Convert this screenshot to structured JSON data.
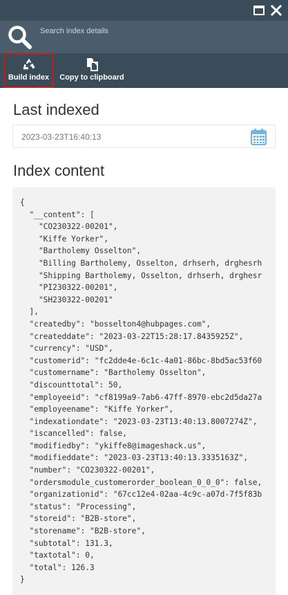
{
  "search": {
    "placeholder": "Search index details"
  },
  "toolbar": {
    "build_label": "Build index",
    "copy_label": "Copy to clipboard"
  },
  "icons": {
    "maximize": "maximize-icon",
    "close": "close-icon",
    "search": "search-icon",
    "build": "recycle-icon",
    "copy": "copy-icon",
    "calendar": "calendar-icon"
  },
  "colors": {
    "titlebar": "#3a4b59",
    "search_bar": "#4b5d6c",
    "highlight_border": "#c01d1d",
    "calendar_icon": "#74b3dc",
    "code_background": "#f2f2f2"
  },
  "last_indexed": {
    "heading": "Last indexed",
    "value": "2023-03-23T16:40:13"
  },
  "index_content": {
    "heading": "Index content",
    "lines": [
      "{",
      "  \"__content\": [",
      "    \"CO230322-00201\",",
      "    \"Kiffe Yorker\",",
      "    \"Bartholemy Osselton\",",
      "    \"Billing Bartholemy, Osselton, drhserh, drghesrh",
      "    \"Shipping Bartholemy, Osselton, drhserh, drghesr",
      "    \"PI230322-00201\",",
      "    \"SH230322-00201\"",
      "  ],",
      "  \"createdby\": \"bosselton4@hubpages.com\",",
      "  \"createddate\": \"2023-03-22T15:28:17.8435925Z\",",
      "  \"currency\": \"USD\",",
      "  \"customerid\": \"fc2dde4e-6c1c-4a01-86bc-8bd5ac53f60",
      "  \"customername\": \"Bartholemy Osselton\",",
      "  \"discounttotal\": 50,",
      "  \"employeeid\": \"cf8199a9-7ab6-47ff-8970-ebc2d5da27a",
      "  \"employeename\": \"Kiffe Yorker\",",
      "  \"indexationdate\": \"2023-03-23T13:40:13.8007274Z\",",
      "  \"iscancelled\": false,",
      "  \"modifiedby\": \"ykiffe8@imageshack.us\",",
      "  \"modifieddate\": \"2023-03-23T13:40:13.3335163Z\",",
      "  \"number\": \"CO230322-00201\",",
      "  \"ordersmodule_customerorder_boolean_0_0_0\": false,",
      "  \"organizationid\": \"67cc12e4-02aa-4c9c-a07d-7f5f83b",
      "  \"status\": \"Processing\",",
      "  \"storeid\": \"B2B-store\",",
      "  \"storename\": \"B2B-store\",",
      "  \"subtotal\": 131.3,",
      "  \"taxtotal\": 0,",
      "  \"total\": 126.3",
      "}"
    ]
  }
}
